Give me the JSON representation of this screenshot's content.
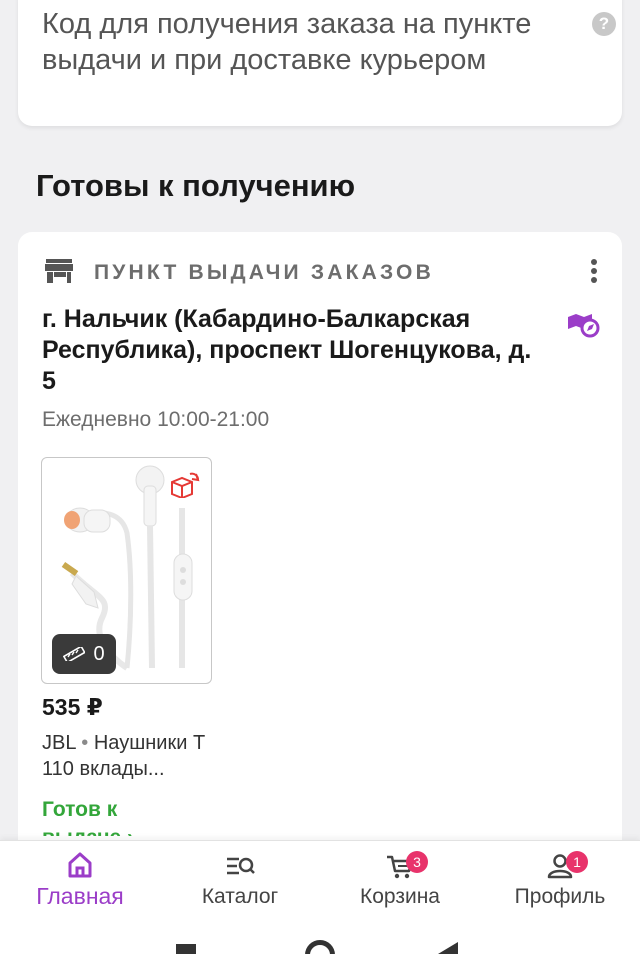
{
  "code_card": {
    "text": "Код для получения заказа на пункте выдачи и при доставке курьером",
    "help_glyph": "?"
  },
  "section_title": "Готовы к получению",
  "pickup": {
    "label": "ПУНКТ ВЫДАЧИ ЗАКАЗОВ",
    "address": "г. Нальчик (Кабардино-Балкарская Республика), проспект Шогенцукова, д. 5",
    "hours": "Ежедневно 10:00-21:00",
    "product": {
      "fitting_count": "0",
      "price": "535 ₽",
      "brand": "JBL",
      "separator": " • ",
      "name": "Наушники T 110 вклады...",
      "status": "Готов к выдаче ›"
    }
  },
  "nav": {
    "items": [
      {
        "label": "Главная",
        "icon": "home-icon",
        "active": true
      },
      {
        "label": "Каталог",
        "icon": "catalog-search-icon",
        "active": false
      },
      {
        "label": "Корзина",
        "icon": "cart-icon",
        "badge": "3",
        "active": false
      },
      {
        "label": "Профиль",
        "icon": "profile-icon",
        "badge": "1",
        "active": false
      }
    ]
  },
  "colors": {
    "accent": "#9b3dc8",
    "status_green": "#33a63a",
    "badge": "#e8336b",
    "delivery_red": "#e53935"
  }
}
